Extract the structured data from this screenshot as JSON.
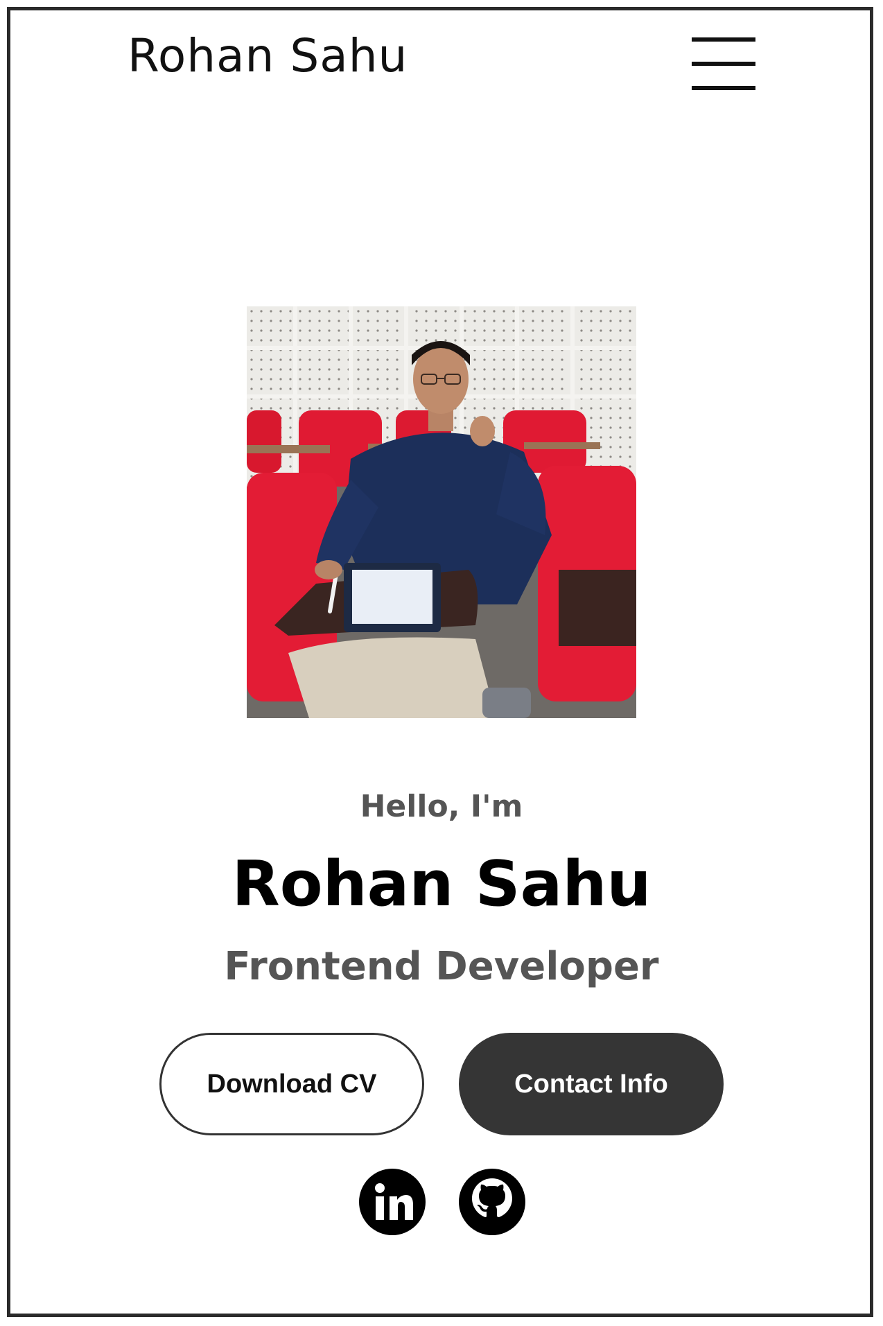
{
  "header": {
    "brand": "Rohan Sahu",
    "menu_icon": "hamburger-menu-icon"
  },
  "hero": {
    "photo_alt": "Portrait of Rohan Sahu",
    "greeting": "Hello, I'm",
    "name": "Rohan Sahu",
    "role": "Frontend Developer"
  },
  "actions": {
    "download_label": "Download CV",
    "contact_label": "Contact Info"
  },
  "social": [
    {
      "icon": "linkedin-icon"
    },
    {
      "icon": "github-icon"
    }
  ],
  "colors": {
    "text_dark": "#111111",
    "text_muted": "#555555",
    "button_dark": "#353535",
    "frame_border": "#2b2b2b"
  }
}
